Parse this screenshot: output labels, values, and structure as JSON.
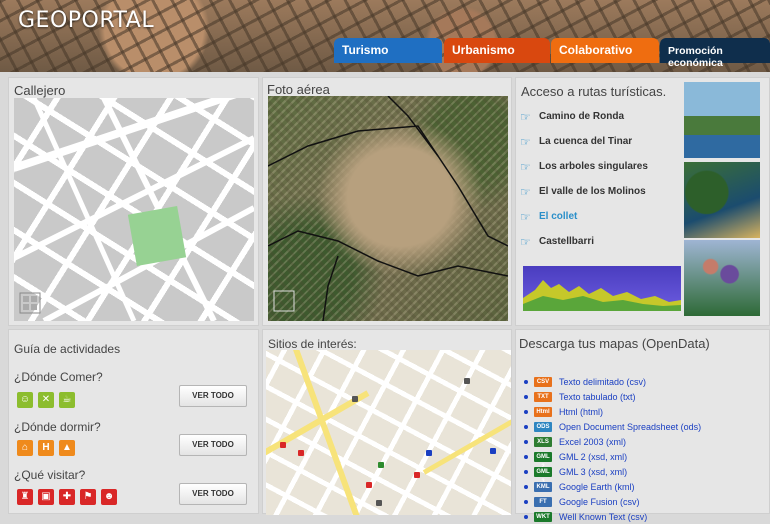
{
  "header": {
    "logo": "GEOPORTAL",
    "tabs": [
      {
        "label": "Turismo",
        "color": "#1f6fc2"
      },
      {
        "label": "Urbanismo",
        "color": "#d9480f"
      },
      {
        "label": "Colaborativo",
        "color": "#ef6d10"
      },
      {
        "label": "Promoción económica",
        "color": "#0f2e4c"
      }
    ]
  },
  "callejero": {
    "title": "Callejero"
  },
  "foto_aerea": {
    "title": "Foto aérea"
  },
  "rutas": {
    "title": "Acceso a rutas turísticas.",
    "items": [
      {
        "label": "Camino de Ronda",
        "icon": "pointing-hand-icon"
      },
      {
        "label": "La cuenca del Tinar",
        "icon": "pointing-hand-icon"
      },
      {
        "label": "Los arboles singulares",
        "icon": "pointing-hand-icon"
      },
      {
        "label": "El valle de los Molinos",
        "icon": "pointing-hand-icon"
      },
      {
        "label": "El collet",
        "icon": "pointing-hand-icon"
      },
      {
        "label": "Castellbarri",
        "icon": "pointing-hand-icon"
      }
    ]
  },
  "actividades": {
    "title": "Guía de actividades",
    "sections": [
      {
        "question": "¿Dónde Comer?",
        "button": "VER TODO",
        "icons": [
          "face-icon",
          "cutlery-icon",
          "cup-icon"
        ]
      },
      {
        "question": "¿Dónde dormir?",
        "button": "VER TODO",
        "icons": [
          "campsite-icon",
          "hotel-icon",
          "tent-icon"
        ]
      },
      {
        "question": "¿Qué visitar?",
        "button": "VER TODO",
        "icons": [
          "museum-icon",
          "monument-icon",
          "church-icon",
          "flag-icon",
          "theater-icon"
        ]
      }
    ]
  },
  "sitios": {
    "title": "Sitios de interés:"
  },
  "descarga": {
    "title": "Descarga tus mapas (OpenData)",
    "items": [
      {
        "badge": "CSV",
        "badge_color": "#e8711b",
        "label": "Texto delimitado (csv)"
      },
      {
        "badge": "TXT",
        "badge_color": "#e8711b",
        "label": "Texto tabulado (txt)"
      },
      {
        "badge": "Html",
        "badge_color": "#e8711b",
        "label": "Html (html)"
      },
      {
        "badge": "ODS",
        "badge_color": "#2e86c1",
        "label": "Open Document Spreadsheet (ods)"
      },
      {
        "badge": "XLS",
        "badge_color": "#2e7d32",
        "label": "Excel 2003 (xml)"
      },
      {
        "badge": "GML 2",
        "badge_color": "#1b7a2b",
        "label": "GML 2 (xsd, xml)"
      },
      {
        "badge": "GML 3",
        "badge_color": "#1b7a2b",
        "label": "GML 3 (xsd, xml)"
      },
      {
        "badge": "KML",
        "badge_color": "#3a6fb0",
        "label": "Google Earth (kml)"
      },
      {
        "badge": "FT",
        "badge_color": "#3a6fb0",
        "label": "Google Fusion (csv)"
      },
      {
        "badge": "WKT",
        "badge_color": "#1b7a2b",
        "label": "Well Known Text (csv)"
      }
    ]
  }
}
